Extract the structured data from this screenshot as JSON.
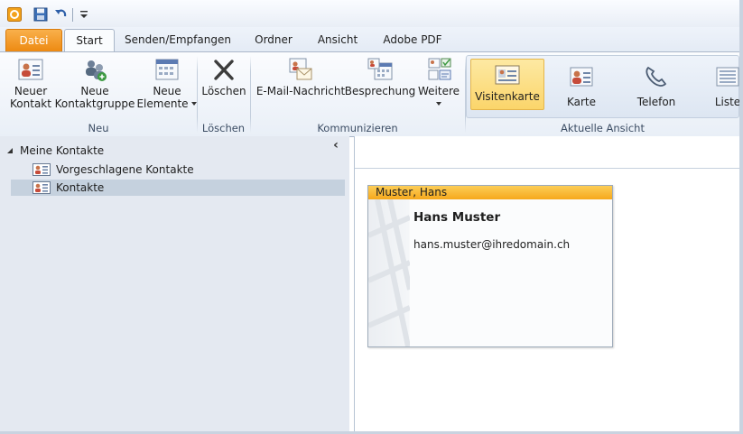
{
  "qat": {
    "icons": [
      "outlook-app-icon",
      "save-icon",
      "undo-icon",
      "customize-qat-icon"
    ]
  },
  "tabs": {
    "datei": "Datei",
    "start": "Start",
    "senden": "Senden/Empfangen",
    "ordner": "Ordner",
    "ansicht": "Ansicht",
    "adobe": "Adobe PDF"
  },
  "ribbon": {
    "neu": {
      "neuer_kontakt_1": "Neuer",
      "neuer_kontakt_2": "Kontakt",
      "gruppe_1": "Neue",
      "gruppe_2": "Kontaktgruppe",
      "elemente_1": "Neue",
      "elemente_2": "Elemente",
      "label": "Neu"
    },
    "loeschen": {
      "button": "Löschen",
      "label": "Löschen"
    },
    "kommunizieren": {
      "email": "E-Mail-Nachricht",
      "besprechung": "Besprechung",
      "weitere": "Weitere",
      "label": "Kommunizieren"
    },
    "ansicht": {
      "visitenkarte": "Visitenkarte",
      "karte": "Karte",
      "telefon": "Telefon",
      "liste": "Liste",
      "label": "Aktuelle Ansicht"
    }
  },
  "nav": {
    "root": "Meine Kontakte",
    "items": [
      {
        "label": "Vorgeschlagene Kontakte"
      },
      {
        "label": "Kontakte"
      }
    ],
    "collapse": "‹"
  },
  "card": {
    "header": "Muster, Hans",
    "name": "Hans Muster",
    "email": "hans.muster@ihredomain.ch"
  },
  "colors": {
    "file_tab": "#ed8a12",
    "card_header": "#f6a81c",
    "selection": "#fbd56a",
    "nav_bg": "#e4e9f1",
    "selected_item": "#c5d1de"
  }
}
